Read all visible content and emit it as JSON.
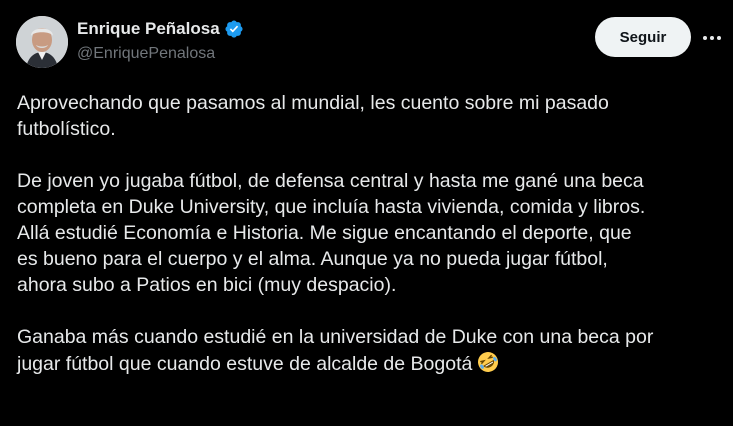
{
  "author": {
    "display_name": "Enrique Peñalosa",
    "handle": "@EnriquePenalosa",
    "verified_icon": "verified-badge-icon",
    "avatar_icon": "avatar-portrait"
  },
  "actions": {
    "follow_label": "Seguir",
    "more_icon": "more-horizontal-icon"
  },
  "tweet": {
    "paragraphs": [
      {
        "lines": [
          "Aprovechando que pasamos al mundial, les cuento sobre mi pasado",
          "futbolístico."
        ]
      },
      {
        "lines": [
          "De joven yo jugaba fútbol, de defensa central y hasta me gané una beca",
          "completa en Duke University, que incluía hasta vivienda, comida y libros.",
          "Allá estudié Economía e Historia. Me sigue encantando el deporte, que",
          "es bueno para el cuerpo y el alma.  Aunque ya no pueda jugar fútbol,",
          "ahora subo a Patios en bici (muy despacio)."
        ]
      },
      {
        "lines": [
          "Ganaba más cuando estudié en la universidad de Duke con una beca por",
          "jugar fútbol que cuando estuve de alcalde de Bogotá"
        ],
        "trailing_emoji": "rolling-on-floor-laughing-emoji"
      }
    ]
  },
  "colors": {
    "background": "#000000",
    "text": "#e7e9ea",
    "muted": "#71767b",
    "verified": "#1d9bf0",
    "button_bg": "#eff3f4"
  }
}
